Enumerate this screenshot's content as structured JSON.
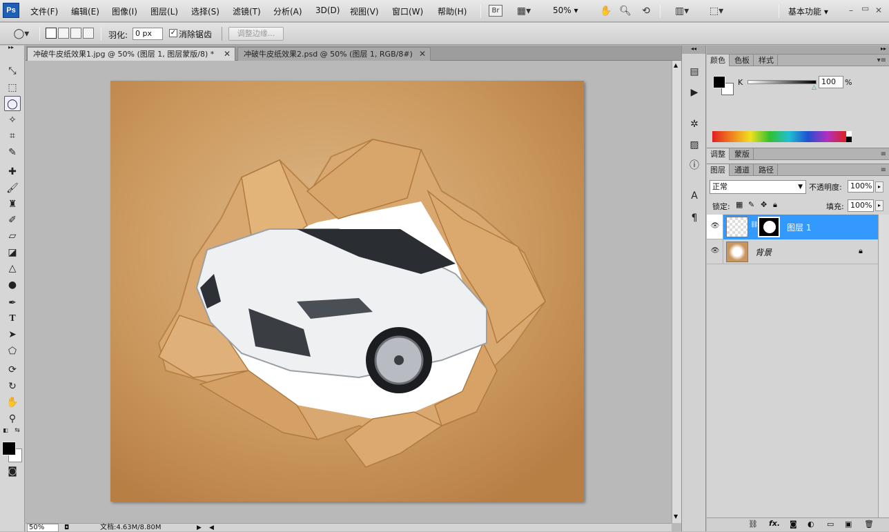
{
  "app": {
    "logo": "Ps"
  },
  "menu": [
    "文件(F)",
    "编辑(E)",
    "图像(I)",
    "图层(L)",
    "选择(S)",
    "滤镜(T)",
    "分析(A)",
    "3D(D)",
    "视图(V)",
    "窗口(W)",
    "帮助(H)"
  ],
  "appbar": {
    "zoom": "50%",
    "workspace": "基本功能"
  },
  "options": {
    "feather_label": "羽化:",
    "feather_value": "0 px",
    "antialias_label": "消除锯齿",
    "antialias_checked": true,
    "refine_label": "调整边缘..."
  },
  "tabs": [
    {
      "title": "冲破牛皮纸效果1.jpg @ 50% (图层 1, 图层蒙版/8) *",
      "active": true
    },
    {
      "title": "冲破牛皮纸效果2.psd @ 50% (图层 1, RGB/8#)",
      "active": false
    }
  ],
  "status": {
    "zoom": "50%",
    "doc_size": "文档:4.63M/8.80M"
  },
  "color_panel": {
    "tabs": [
      "颜色",
      "色板",
      "样式"
    ],
    "channel_label": "K",
    "value": "100",
    "unit": "%",
    "foreground": "#000000",
    "background": "#ffffff"
  },
  "adjust_panel": {
    "tabs": [
      "调整",
      "蒙版"
    ]
  },
  "layers_panel": {
    "tabs": [
      "图层",
      "通道",
      "路径"
    ],
    "blend_mode": "正常",
    "opacity_label": "不透明度:",
    "opacity": "100%",
    "lock_label": "锁定:",
    "fill_label": "填充:",
    "fill": "100%",
    "layers": [
      {
        "name": "图层 1",
        "selected": true,
        "has_mask": true
      },
      {
        "name": "背景",
        "selected": false,
        "locked": true
      }
    ]
  },
  "colors": {
    "selection": "#3399ff",
    "panel_bg": "#d4d4d4",
    "paper": "#c8955c"
  }
}
